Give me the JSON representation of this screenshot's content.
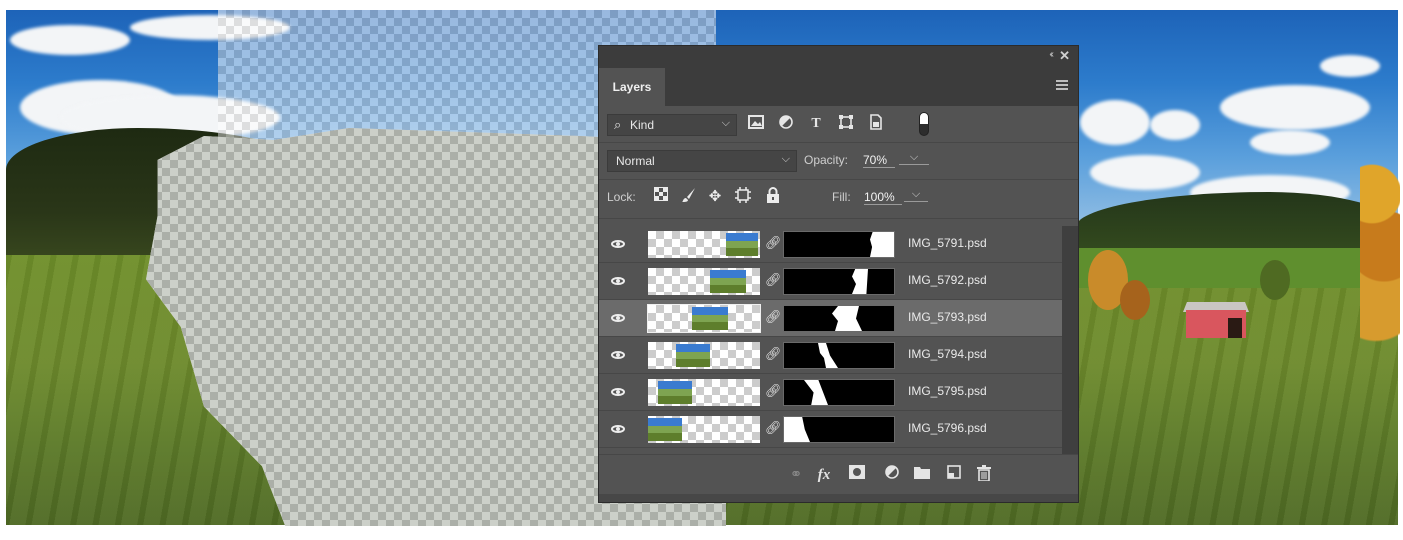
{
  "panel": {
    "tab_label": "Layers",
    "collapse_glyph": "‹‹",
    "close_glyph": "✕"
  },
  "filter": {
    "kind_label": "Kind",
    "icons": [
      "image-filter-icon",
      "adjustment-filter-icon",
      "type-filter-icon",
      "shape-filter-icon",
      "smart-object-filter-icon",
      "filter-toggle-icon"
    ]
  },
  "blend": {
    "mode": "Normal",
    "opacity_label": "Opacity:",
    "opacity_value": "70%"
  },
  "lock": {
    "label": "Lock:",
    "fill_label": "Fill:",
    "fill_value": "100%"
  },
  "layers": [
    {
      "name": "IMG_5791.psd",
      "selected": false,
      "visible": true
    },
    {
      "name": "IMG_5792.psd",
      "selected": false,
      "visible": true
    },
    {
      "name": "IMG_5793.psd",
      "selected": true,
      "visible": true
    },
    {
      "name": "IMG_5794.psd",
      "selected": false,
      "visible": true
    },
    {
      "name": "IMG_5795.psd",
      "selected": false,
      "visible": true
    },
    {
      "name": "IMG_5796.psd",
      "selected": false,
      "visible": true
    }
  ],
  "bottom_bar": {
    "fx_label": "fx",
    "icons": [
      "link-layers-icon",
      "fx-icon",
      "add-mask-icon",
      "adjustment-layer-icon",
      "new-group-icon",
      "new-layer-icon",
      "delete-layer-icon"
    ]
  }
}
